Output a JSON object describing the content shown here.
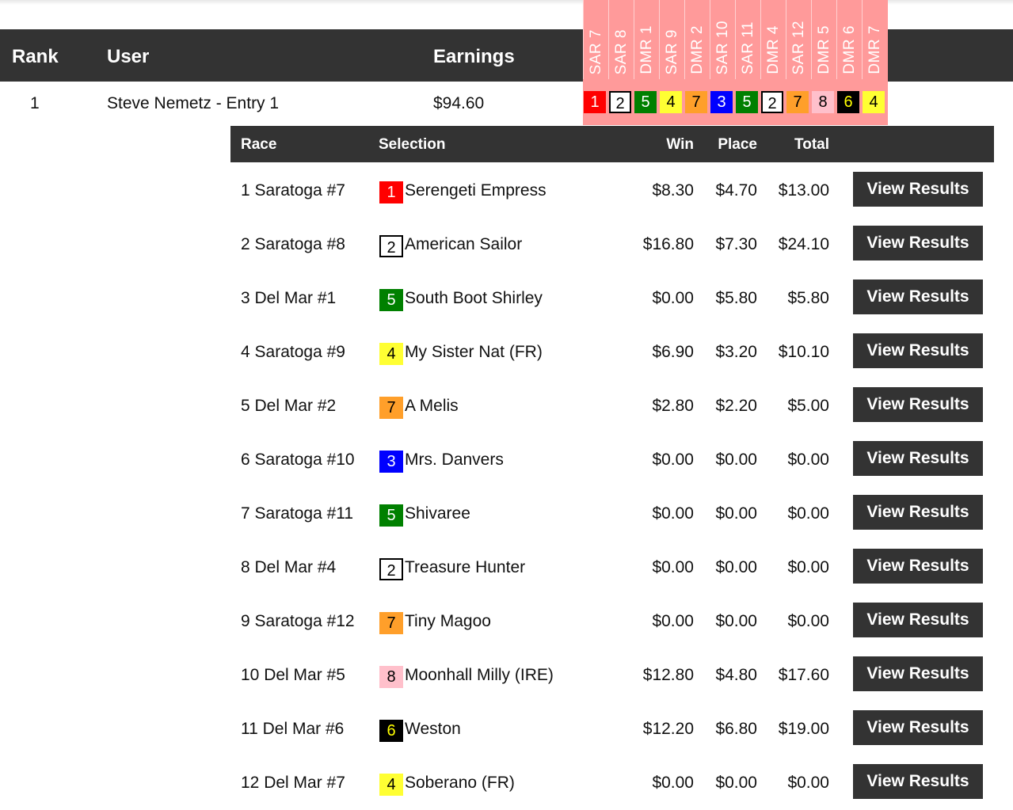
{
  "leaderboard": {
    "headers": {
      "rank": "Rank",
      "user": "User",
      "earnings": "Earnings"
    },
    "races": [
      "SAR 7",
      "SAR 8",
      "DMR 1",
      "SAR 9",
      "DMR 2",
      "SAR 10",
      "SAR 11",
      "DMR 4",
      "SAR 12",
      "DMR 5",
      "DMR 6",
      "DMR 7"
    ],
    "entry": {
      "rank": "1",
      "user": "Steve Nemetz - Entry 1",
      "earnings": "$94.60",
      "picks": [
        {
          "num": "1",
          "bg": "#ff0000",
          "fg": "#ffffff",
          "border": "none"
        },
        {
          "num": "2",
          "bg": "#ffffff",
          "fg": "#000000",
          "border": "#000000"
        },
        {
          "num": "5",
          "bg": "#008000",
          "fg": "#ffffff",
          "border": "none"
        },
        {
          "num": "4",
          "bg": "#ffff33",
          "fg": "#000000",
          "border": "none"
        },
        {
          "num": "7",
          "bg": "#ff9f2a",
          "fg": "#000000",
          "border": "none"
        },
        {
          "num": "3",
          "bg": "#0000ff",
          "fg": "#ffffff",
          "border": "none"
        },
        {
          "num": "5",
          "bg": "#008000",
          "fg": "#ffffff",
          "border": "none"
        },
        {
          "num": "2",
          "bg": "#ffffff",
          "fg": "#000000",
          "border": "#000000"
        },
        {
          "num": "7",
          "bg": "#ff9f2a",
          "fg": "#000000",
          "border": "none"
        },
        {
          "num": "8",
          "bg": "#ffc0cb",
          "fg": "#000000",
          "border": "none"
        },
        {
          "num": "6",
          "bg": "#000000",
          "fg": "#ffff00",
          "border": "none"
        },
        {
          "num": "4",
          "bg": "#ffff33",
          "fg": "#000000",
          "border": "none"
        }
      ]
    },
    "colors": {
      "dark": "#333333",
      "strip": "#ff9a9a"
    }
  },
  "details": {
    "headers": {
      "race": "Race",
      "selection": "Selection",
      "win": "Win",
      "place": "Place",
      "total": "Total"
    },
    "button_label": "View Results",
    "rows": [
      {
        "race": "1 Saratoga #7",
        "num": "1",
        "horse": "Serengeti Empress",
        "win": "$8.30",
        "place": "$4.70",
        "total": "$13.00"
      },
      {
        "race": "2 Saratoga #8",
        "num": "2",
        "horse": "American Sailor",
        "win": "$16.80",
        "place": "$7.30",
        "total": "$24.10"
      },
      {
        "race": "3 Del Mar #1",
        "num": "5",
        "horse": "South Boot Shirley",
        "win": "$0.00",
        "place": "$5.80",
        "total": "$5.80"
      },
      {
        "race": "4 Saratoga #9",
        "num": "4",
        "horse": "My Sister Nat (FR)",
        "win": "$6.90",
        "place": "$3.20",
        "total": "$10.10"
      },
      {
        "race": "5 Del Mar #2",
        "num": "7",
        "horse": "A Melis",
        "win": "$2.80",
        "place": "$2.20",
        "total": "$5.00"
      },
      {
        "race": "6 Saratoga #10",
        "num": "3",
        "horse": "Mrs. Danvers",
        "win": "$0.00",
        "place": "$0.00",
        "total": "$0.00"
      },
      {
        "race": "7 Saratoga #11",
        "num": "5",
        "horse": "Shivaree",
        "win": "$0.00",
        "place": "$0.00",
        "total": "$0.00"
      },
      {
        "race": "8 Del Mar #4",
        "num": "2",
        "horse": "Treasure Hunter",
        "win": "$0.00",
        "place": "$0.00",
        "total": "$0.00"
      },
      {
        "race": "9 Saratoga #12",
        "num": "7",
        "horse": "Tiny Magoo",
        "win": "$0.00",
        "place": "$0.00",
        "total": "$0.00"
      },
      {
        "race": "10 Del Mar #5",
        "num": "8",
        "horse": "Moonhall Milly (IRE)",
        "win": "$12.80",
        "place": "$4.80",
        "total": "$17.60"
      },
      {
        "race": "11 Del Mar #6",
        "num": "6",
        "horse": "Weston",
        "win": "$12.20",
        "place": "$6.80",
        "total": "$19.00"
      },
      {
        "race": "12 Del Mar #7",
        "num": "4",
        "horse": "Soberano (FR)",
        "win": "$0.00",
        "place": "$0.00",
        "total": "$0.00"
      }
    ]
  }
}
